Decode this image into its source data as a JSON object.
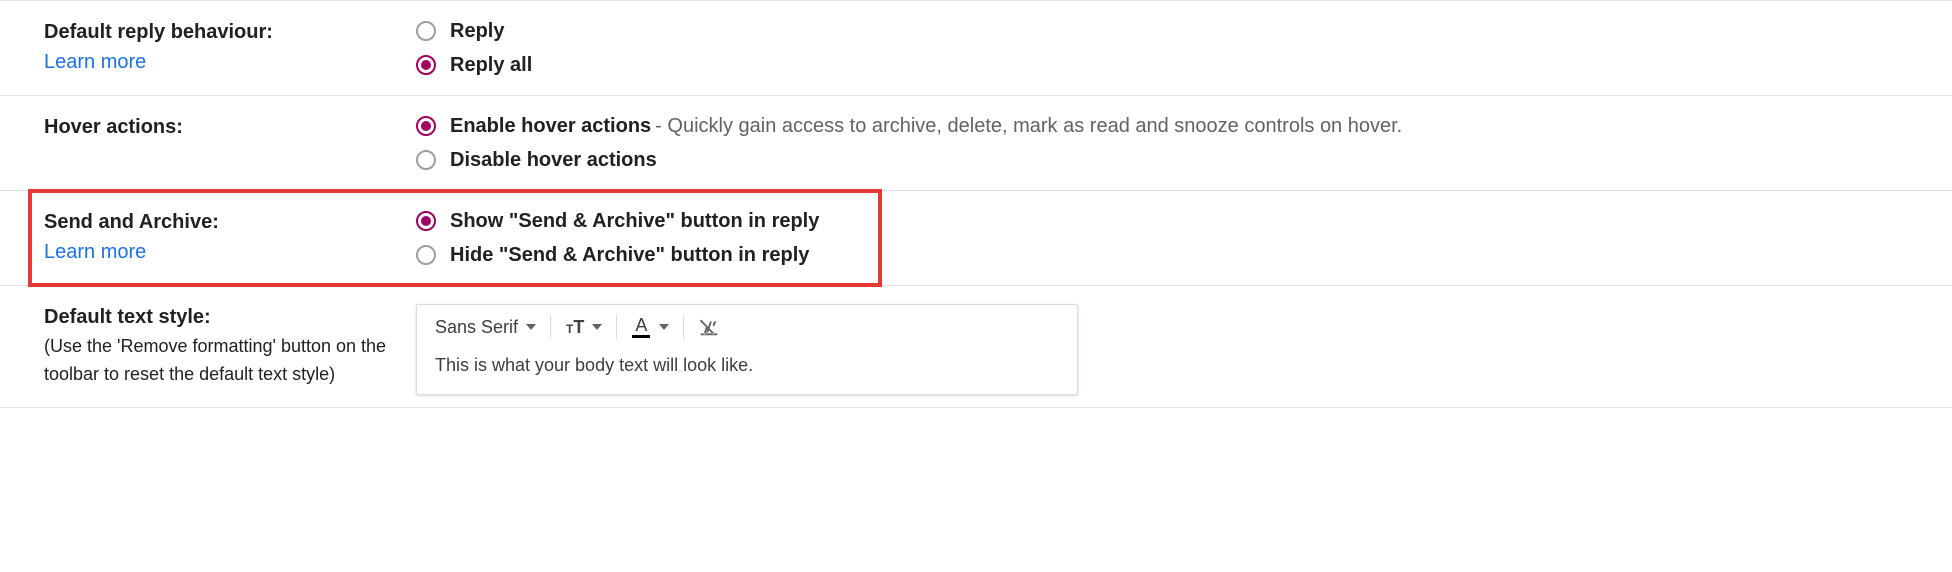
{
  "learn_more": "Learn more",
  "reply": {
    "title": "Default reply behaviour:",
    "options": [
      "Reply",
      "Reply all"
    ],
    "selected": 1
  },
  "hover": {
    "title": "Hover actions:",
    "options": [
      {
        "label": "Enable hover actions",
        "desc": " - Quickly gain access to archive, delete, mark as read and snooze controls on hover."
      },
      {
        "label": "Disable hover actions",
        "desc": ""
      }
    ],
    "selected": 0
  },
  "send_archive": {
    "title": "Send and Archive:",
    "options": [
      "Show \"Send & Archive\" button in reply",
      "Hide \"Send & Archive\" button in reply"
    ],
    "selected": 0
  },
  "text_style": {
    "title": "Default text style:",
    "hint": "(Use the 'Remove formatting' button on the toolbar to reset the default text style)",
    "font_name": "Sans Serif",
    "preview": "This is what your body text will look like."
  }
}
